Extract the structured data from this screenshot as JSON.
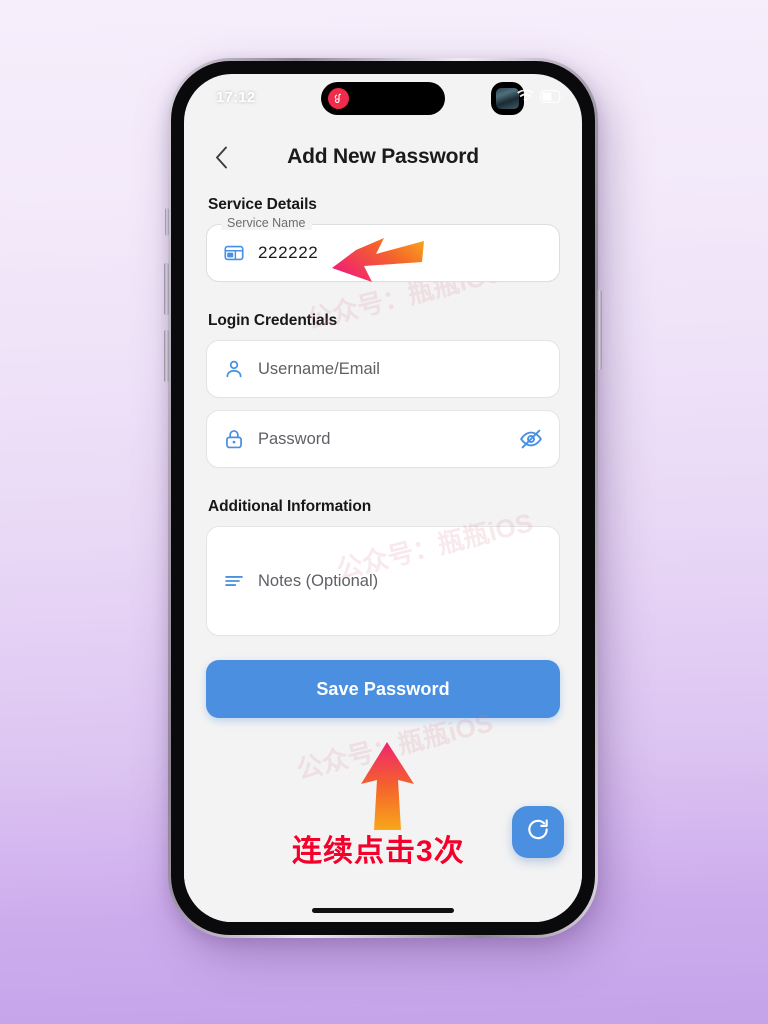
{
  "status_bar": {
    "time": "17:12",
    "music_icon": "netease-music-icon",
    "wifi_icon": "wifi-icon",
    "battery_icon": "battery-icon"
  },
  "navbar": {
    "back_icon": "back-chevron-icon",
    "title": "Add New Password"
  },
  "sections": {
    "service": {
      "title": "Service Details",
      "field": {
        "label": "Service Name",
        "value": "222222",
        "icon": "card-window-icon"
      }
    },
    "login": {
      "title": "Login Credentials",
      "username": {
        "placeholder": "Username/Email",
        "icon": "person-icon"
      },
      "password": {
        "placeholder": "Password",
        "icon": "lock-icon",
        "toggle_icon": "eye-off-icon"
      }
    },
    "additional": {
      "title": "Additional Information",
      "notes": {
        "placeholder": "Notes (Optional)",
        "icon": "list-lines-icon"
      }
    }
  },
  "actions": {
    "save_label": "Save Password",
    "save_color": "#4a8fe0",
    "fab_icon": "refresh-icon",
    "fab_color": "#4a8fe0"
  },
  "annotations": {
    "instruction_text": "连续点击3次",
    "instruction_color": "#f4002a",
    "arrow_gradient_start": "#f5a623",
    "arrow_gradient_end": "#f0256f"
  },
  "watermark": {
    "text": "公众号：瓶瓶iOS"
  }
}
